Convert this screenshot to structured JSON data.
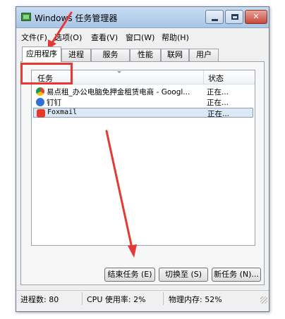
{
  "window": {
    "title": "Windows 任务管理器",
    "accent": "#e53935"
  },
  "menu": [
    "文件(F)",
    "选项(O)",
    "查看(V)",
    "窗口(W)",
    "帮助(H)"
  ],
  "tabs": [
    "应用程序",
    "进程",
    "服务",
    "性能",
    "联网",
    "用户"
  ],
  "active_tab": "应用程序",
  "list": {
    "columns": [
      "任务",
      "状态"
    ],
    "rows": [
      {
        "icon": "chrome-icon",
        "name": "易点租_办公电脑免押金租赁电商 - Googl...",
        "status": "正在..."
      },
      {
        "icon": "dingtalk-icon",
        "name": "钉钉",
        "status": "正在..."
      },
      {
        "icon": "foxmail-icon",
        "name": "Foxmail",
        "status": "正在...",
        "selected": true
      }
    ]
  },
  "buttons": {
    "end_task": "结束任务 (E)",
    "switch_to": "切换至 (S)",
    "new_task": "新任务 (N)..."
  },
  "statusbar": {
    "processes": "进程数: 80",
    "cpu": "CPU 使用率: 2%",
    "memory": "物理内存: 52%"
  }
}
